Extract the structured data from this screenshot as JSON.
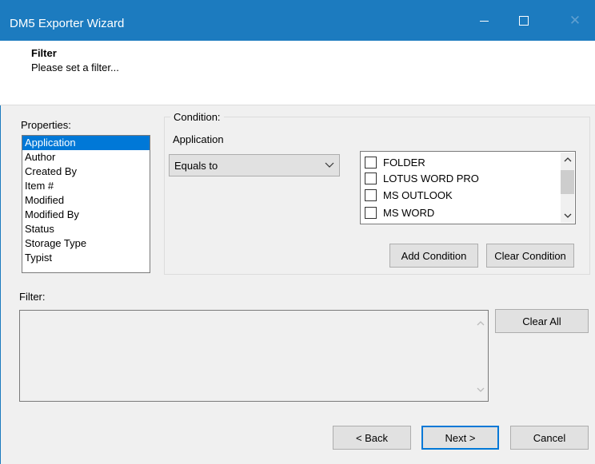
{
  "window": {
    "title": "DM5 Exporter Wizard",
    "controls": {
      "minimize_icon": "minimize-icon",
      "maximize_icon": "maximize-icon",
      "close_icon": "close-icon",
      "close_glyph": "✕"
    },
    "accent_color": "#1c7bbf"
  },
  "header": {
    "title": "Filter",
    "subtitle": "Please set a filter..."
  },
  "properties": {
    "label": "Properties:",
    "items": [
      "Application",
      "Author",
      "Created By",
      "Item #",
      "Modified",
      "Modified By",
      "Status",
      "Storage Type",
      "Typist"
    ],
    "selected": "Application"
  },
  "condition": {
    "legend": "Condition:",
    "property_name": "Application",
    "operator": "Equals to",
    "values": [
      {
        "label": "FOLDER",
        "checked": false
      },
      {
        "label": "LOTUS WORD PRO",
        "checked": false
      },
      {
        "label": "MS OUTLOOK",
        "checked": false
      },
      {
        "label": "MS WORD",
        "checked": false
      }
    ],
    "add_button": "Add Condition",
    "clear_button": "Clear Condition"
  },
  "filter": {
    "label": "Filter:",
    "text": "",
    "clear_all_button": "Clear All"
  },
  "footer": {
    "back_button": "< Back",
    "next_button": "Next >",
    "cancel_button": "Cancel"
  }
}
